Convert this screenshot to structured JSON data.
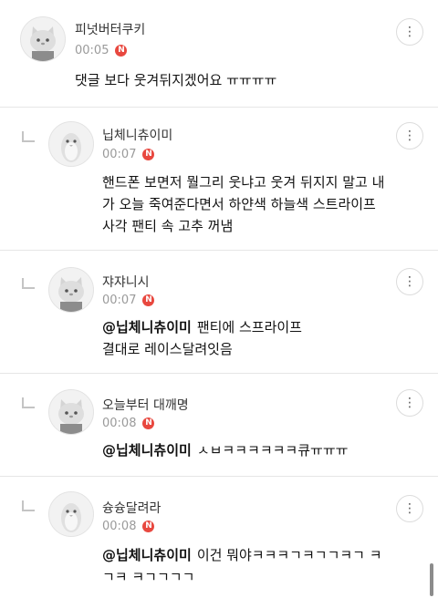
{
  "more_icon": "⋮",
  "new_badge": "N",
  "comments": [
    {
      "nick": "피넛버터쿠키",
      "time": "00:05",
      "mention": "",
      "lines": [
        "댓글 보다 웃겨뒤지겠어요 ㅠㅠㅠㅠ"
      ],
      "avatar": "cat-avatar-icon"
    },
    {
      "nick": "닙체니츄이미",
      "time": "00:07",
      "mention": "",
      "lines": [
        "핸드폰 보면저 뭘그리 웃냐고 웃겨 뒤지지 말고 내",
        "가 오늘 죽여준다면서 하얀색 하늘색 스트라이프",
        "사각 팬티 속 고추 꺼냄"
      ],
      "avatar": "penguin-avatar-icon"
    },
    {
      "nick": "쟈쟈니시",
      "time": "00:07",
      "mention": "@닙체니츄이미",
      "lines": [
        "팬티에 스프라이프",
        "결대로 레이스달려잇음"
      ],
      "avatar": "cat-avatar-icon"
    },
    {
      "nick": "오늘부터 대깨명",
      "time": "00:08",
      "mention": "@닙체니츄이미",
      "lines": [
        "ㅅㅂㅋㅋㅋㅋㅋㅋ큐ㅠㅠㅠ"
      ],
      "avatar": "cat-avatar-icon"
    },
    {
      "nick": "슝슝달려라",
      "time": "00:08",
      "mention": "@닙체니츄이미",
      "lines": [
        "이건 뭐야ㅋㅋㅋㄱㅋㄱㄱㅋㄱ ㅋ",
        "ㄱㅋ ㅋㄱㄱㄱㄱ"
      ],
      "avatar": "penguin-avatar-icon"
    }
  ]
}
